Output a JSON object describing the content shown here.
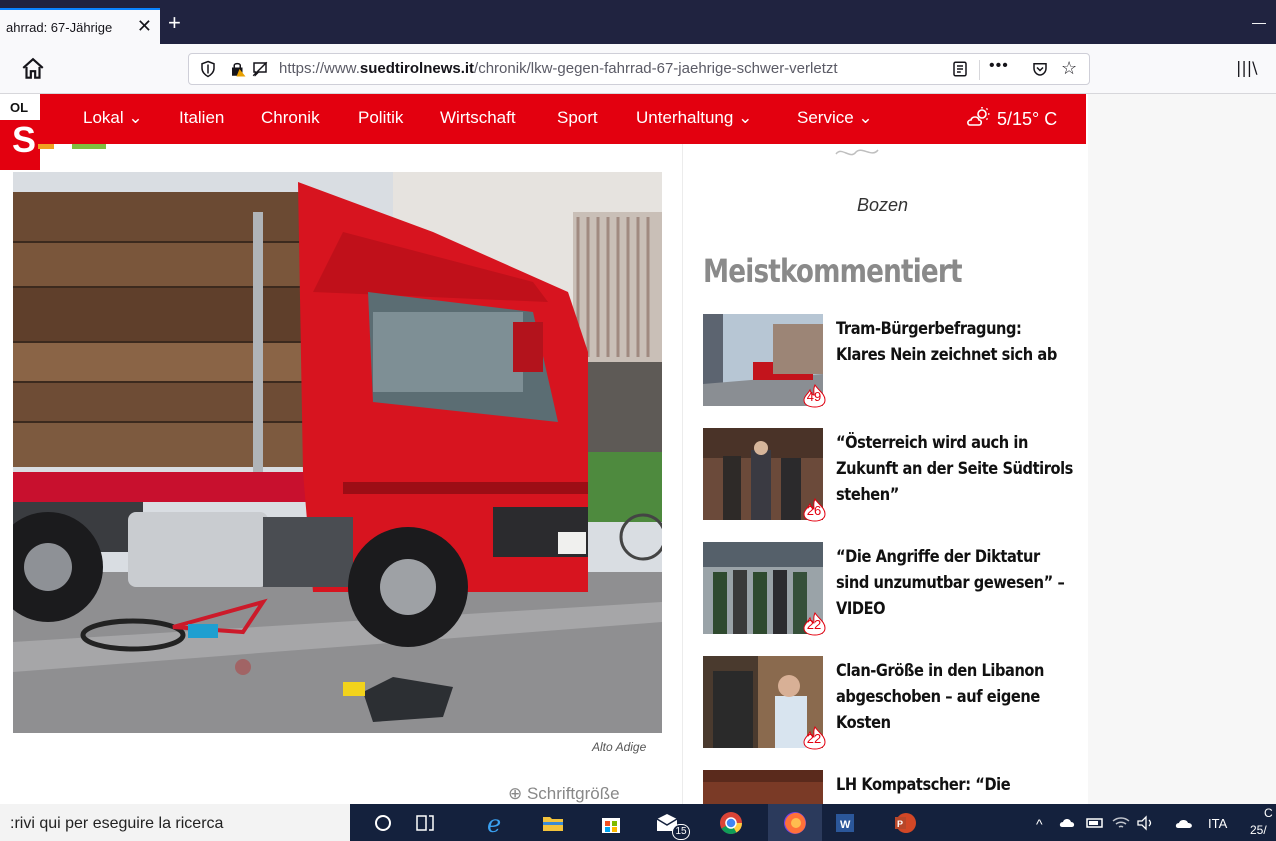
{
  "browser": {
    "tab_title": "ahrrad: 67-Jährige",
    "tab_close": "✕",
    "new_tab": "+",
    "minimize": "—",
    "url_prefix": "https://www.",
    "url_domain": "suedtirolnews.it",
    "url_path": "/chronik/lkw-gegen-fahrrad-67-jaehrige-schwer-verletzt",
    "more_actions": "•••"
  },
  "site_nav": {
    "logo_text_top": "OL",
    "logo_text_big": "S",
    "items": [
      {
        "label": "Lokal ⌄"
      },
      {
        "label": "Italien"
      },
      {
        "label": "Chronik"
      },
      {
        "label": "Politik"
      },
      {
        "label": "Wirtschaft"
      },
      {
        "label": "Sport"
      },
      {
        "label": "Unterhaltung ⌄"
      },
      {
        "label": "Service ⌄"
      }
    ],
    "weather": "5/15° C"
  },
  "main": {
    "photo_caption": "Alto Adige",
    "font_size_label": "⊕ Schriftgröße"
  },
  "sidebar": {
    "city": "Bozen",
    "section_title": "Meistkommentiert",
    "articles": [
      {
        "title_lines": [
          "Tram-Bürgerbefragung:",
          "Klares Nein zeichnet sich ab"
        ],
        "comments": "49"
      },
      {
        "title_lines": [
          "“Österreich wird auch in",
          "Zukunft an der Seite Südtirols",
          "stehen”"
        ],
        "comments": "26"
      },
      {
        "title_lines": [
          "“Die Angriffe der Diktatur",
          "sind unzumutbar gewesen” –",
          "VIDEO"
        ],
        "comments": "22"
      },
      {
        "title_lines": [
          "Clan-Größe in den Libanon",
          "abgeschoben – auf eigene",
          "Kosten"
        ],
        "comments": "22"
      },
      {
        "title_lines": [
          "LH Kompatscher: “Die"
        ],
        "comments": ""
      }
    ]
  },
  "taskbar": {
    "search_placeholder": ":rivi qui per eseguire la ricerca",
    "mail_badge": "15",
    "language": "ITA",
    "clock_top": "C",
    "clock_bottom": "25/"
  },
  "colors": {
    "brand_red": "#e3000f",
    "tab_bar": "#202340",
    "taskbar": "#14213d"
  }
}
